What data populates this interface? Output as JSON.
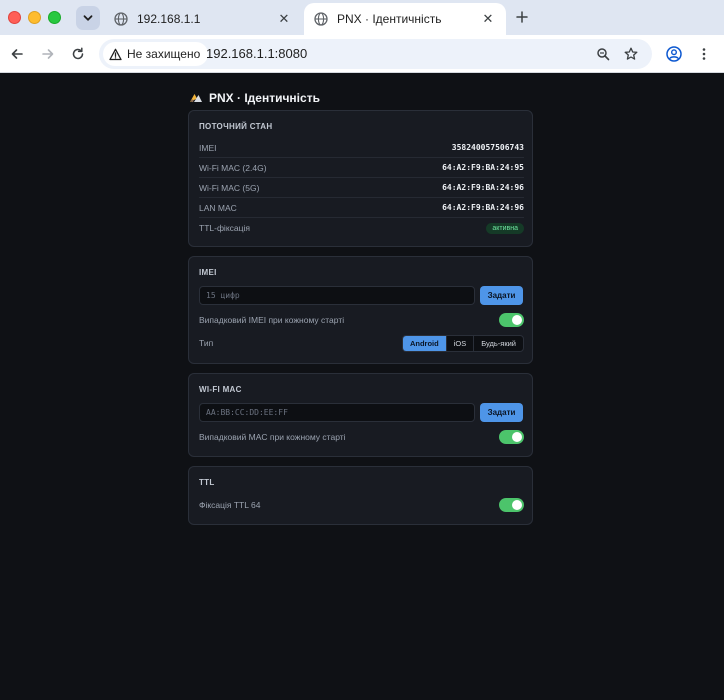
{
  "browser": {
    "tabs": [
      {
        "title": "192.168.1.1",
        "active": false
      },
      {
        "title": "PNX · Ідентичність",
        "active": true
      }
    ],
    "security_label": "Не захищено",
    "url": "192.168.1.1:8080"
  },
  "page": {
    "title": "PNX · Ідентичність"
  },
  "status": {
    "title": "Поточний стан",
    "rows": [
      {
        "label": "IMEI",
        "value": "358240057506743"
      },
      {
        "label": "Wi-Fi MAC (2.4G)",
        "value": "64:A2:F9:BA:24:95"
      },
      {
        "label": "Wi-Fi MAC (5G)",
        "value": "64:A2:F9:BA:24:96"
      },
      {
        "label": "LAN MAC",
        "value": "64:A2:F9:BA:24:96"
      }
    ],
    "ttl_label": "TTL-фіксація",
    "ttl_badge": "активна"
  },
  "imei": {
    "title": "IMEI",
    "placeholder": "15 цифр",
    "set_label": "Задати",
    "random_label": "Випадковий IMEI при кожному старті",
    "random_on": true,
    "type_label": "Тип",
    "type_options": [
      "Android",
      "iOS",
      "Будь-який"
    ],
    "type_selected": "Android"
  },
  "wifi_mac": {
    "title": "Wi-Fi MAC",
    "placeholder": "AA:BB:CC:DD:EE:FF",
    "set_label": "Задати",
    "random_label": "Випадковий MAC при кожному старті",
    "random_on": true
  },
  "ttl": {
    "title": "TTL",
    "fix_label": "Фіксація TTL 64",
    "fix_on": true
  },
  "colors": {
    "accent": "#4e95e8",
    "toggle_on": "#4cc46b",
    "badge_text": "#6ee7a0",
    "page_bg": "#0f1115",
    "card_bg": "#181b22"
  },
  "icons": [
    "globe-icon",
    "warning-triangle-icon",
    "zoom-icon",
    "star-icon",
    "profile-icon",
    "kebab-menu-icon",
    "logo-icon"
  ]
}
